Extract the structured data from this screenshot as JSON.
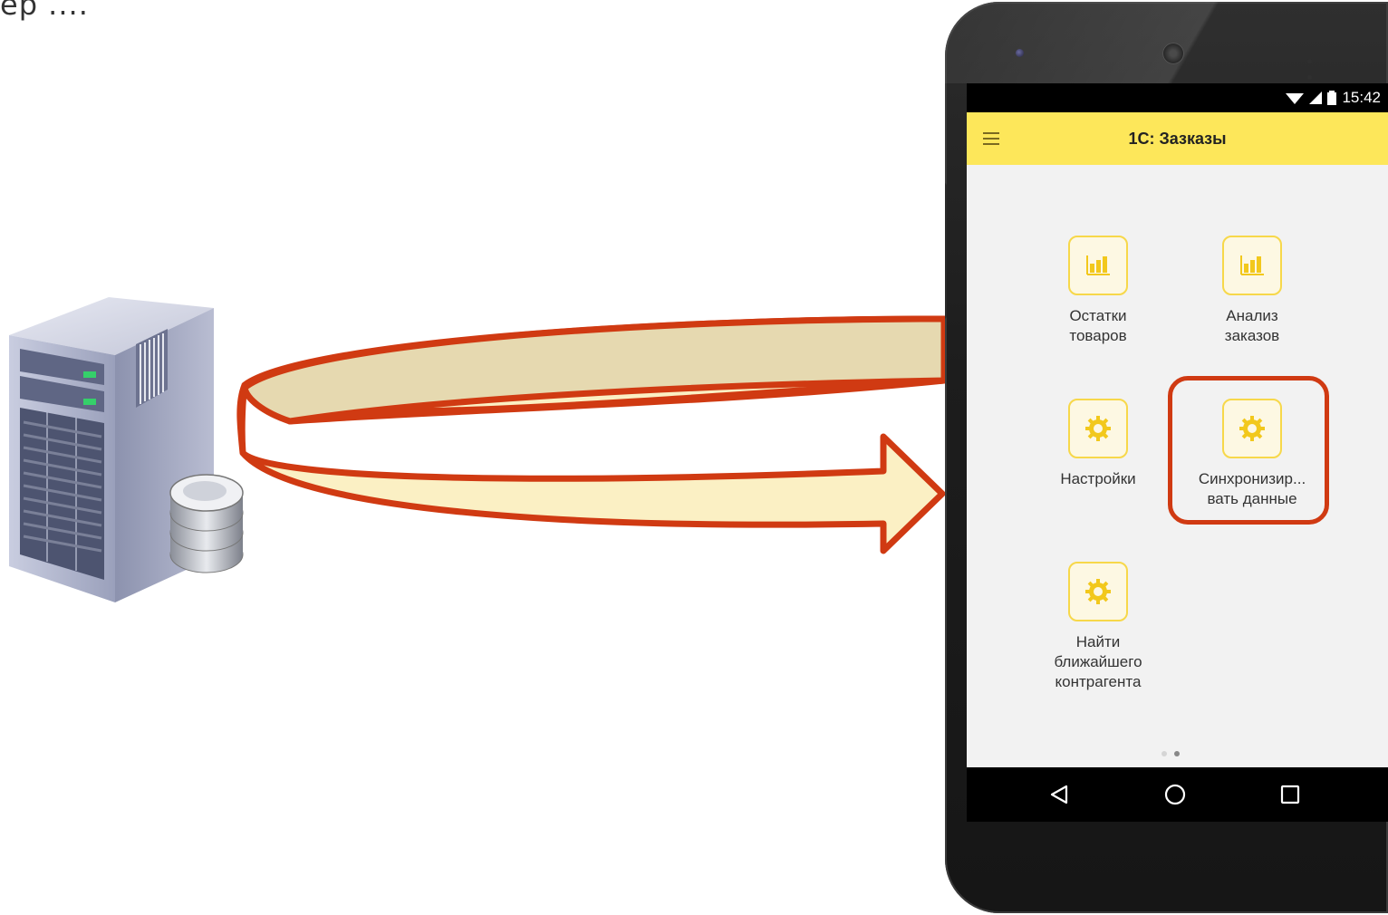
{
  "caption": "ер ....",
  "phone": {
    "status": {
      "time": "15:42"
    },
    "appbar": {
      "title": "1С: Зазказы"
    },
    "tiles": [
      {
        "line1": "Остатки",
        "line2": "товаров",
        "line3": "",
        "icon": "bar-chart-icon"
      },
      {
        "line1": "Анализ",
        "line2": "заказов",
        "line3": "",
        "icon": "bar-chart-icon"
      },
      {
        "line1": "Настройки",
        "line2": "",
        "line3": "",
        "icon": "gear-icon"
      },
      {
        "line1": "Синхронизир...",
        "line2": "вать данные",
        "line3": "",
        "icon": "gear-icon"
      },
      {
        "line1": "Найти",
        "line2": "ближайшего",
        "line3": "контрагента",
        "icon": "gear-icon"
      }
    ],
    "pager": {
      "pages": 2,
      "current": 2
    },
    "nav": [
      "back-icon",
      "home-icon",
      "recents-icon"
    ]
  },
  "colors": {
    "accent_yellow": "#fde75a",
    "arrow_outline": "#d03a12",
    "arrow_fill_top": "#e6d9b0",
    "arrow_fill_bottom": "#fbf0c4"
  }
}
